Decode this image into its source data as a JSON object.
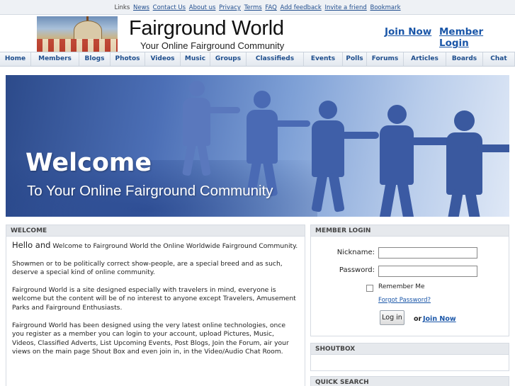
{
  "toplinks": {
    "items": [
      {
        "label": "Links",
        "underlined": false
      },
      {
        "label": "News",
        "underlined": true
      },
      {
        "label": "Contact Us",
        "underlined": true
      },
      {
        "label": "About us",
        "underlined": true
      },
      {
        "label": "Privacy",
        "underlined": true
      },
      {
        "label": "Terms",
        "underlined": true
      },
      {
        "label": "FAQ",
        "underlined": true
      },
      {
        "label": "Add feedback",
        "underlined": true
      },
      {
        "label": "Invite a friend",
        "underlined": true
      },
      {
        "label": "Bookmark",
        "underlined": true
      }
    ]
  },
  "header": {
    "title": "Fairground World",
    "tagline": "Your Online Fairground Community",
    "join_label": "Join Now",
    "login_label": "Member Login"
  },
  "nav": {
    "items": [
      "Home",
      "Members",
      "Blogs",
      "Photos",
      "Videos",
      "Music",
      "Groups",
      "Classifieds",
      "Events",
      "Polls",
      "Forums",
      "Articles",
      "Boards",
      "Chat"
    ]
  },
  "banner": {
    "welcome": "Welcome",
    "subline": "To Your Online Fairground Community"
  },
  "welcome_panel": {
    "heading": "WELCOME",
    "hello": "Hello and",
    "intro": "Welcome to Fairground World the Online Worldwide Fairground Community.",
    "p2": "Showmen or to be politically correct show-people, are a special breed and as such, deserve a special kind of online community.",
    "p3": "Fairground World is a site designed especially with travelers in mind, everyone is welcome but the content will be of no interest to anyone except Travelers, Amusement Parks and Fairground Enthusiasts.",
    "p4": "Fairground World has been designed using the very latest online technologies, once you register as a member you can login to your account, upload Pictures, Music, Videos, Classified Adverts, List Upcoming Events, Post Blogs, Join the Forum, air your views on the main page Shout Box and even join in, in the Video/Audio Chat Room."
  },
  "login_panel": {
    "heading": "MEMBER LOGIN",
    "nickname_label": "Nickname:",
    "nickname_value": "",
    "password_label": "Password:",
    "password_value": "",
    "remember_label": "Remember Me",
    "remember_checked": false,
    "forgot_label": "Forgot Password?",
    "login_button": "Log in",
    "or_label": "or",
    "join_label": "Join Now"
  },
  "shoutbox": {
    "heading": "SHOUTBOX"
  },
  "quick_search": {
    "heading": "QUICK SEARCH"
  },
  "colors": {
    "link": "#1a56a8",
    "nav_text": "#1d4d8c",
    "panel_header": "#e6e9ed"
  }
}
